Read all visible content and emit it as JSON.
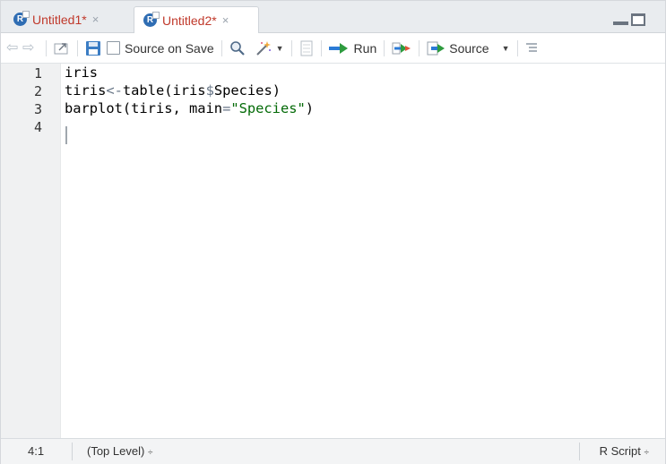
{
  "tabs": [
    {
      "label": "Untitled1*",
      "close": "×"
    },
    {
      "label": "Untitled2*",
      "close": "×"
    }
  ],
  "toolbar": {
    "source_on_save": "Source on Save",
    "run": "Run",
    "source": "Source"
  },
  "editor": {
    "line_numbers": [
      "1",
      "2",
      "3",
      "4"
    ],
    "lines": {
      "l1": "iris",
      "l2_a": "tiris",
      "l2_op": "<-",
      "l2_b": "table(iris",
      "l2_dollar": "$",
      "l2_c": "Species)",
      "l3_a": "barplot(tiris, main",
      "l3_eq": "=",
      "l3_str": "\"Species\"",
      "l3_b": ")"
    }
  },
  "statusbar": {
    "position": "4:1",
    "scope": "(Top Level)",
    "file_type": "R Script",
    "updown": "÷"
  },
  "colors": {
    "tab_text": "#c0392b",
    "string": "#036a07",
    "run_arrow_blue": "#2b7bd6",
    "run_arrow_green": "#2e9b3f"
  }
}
